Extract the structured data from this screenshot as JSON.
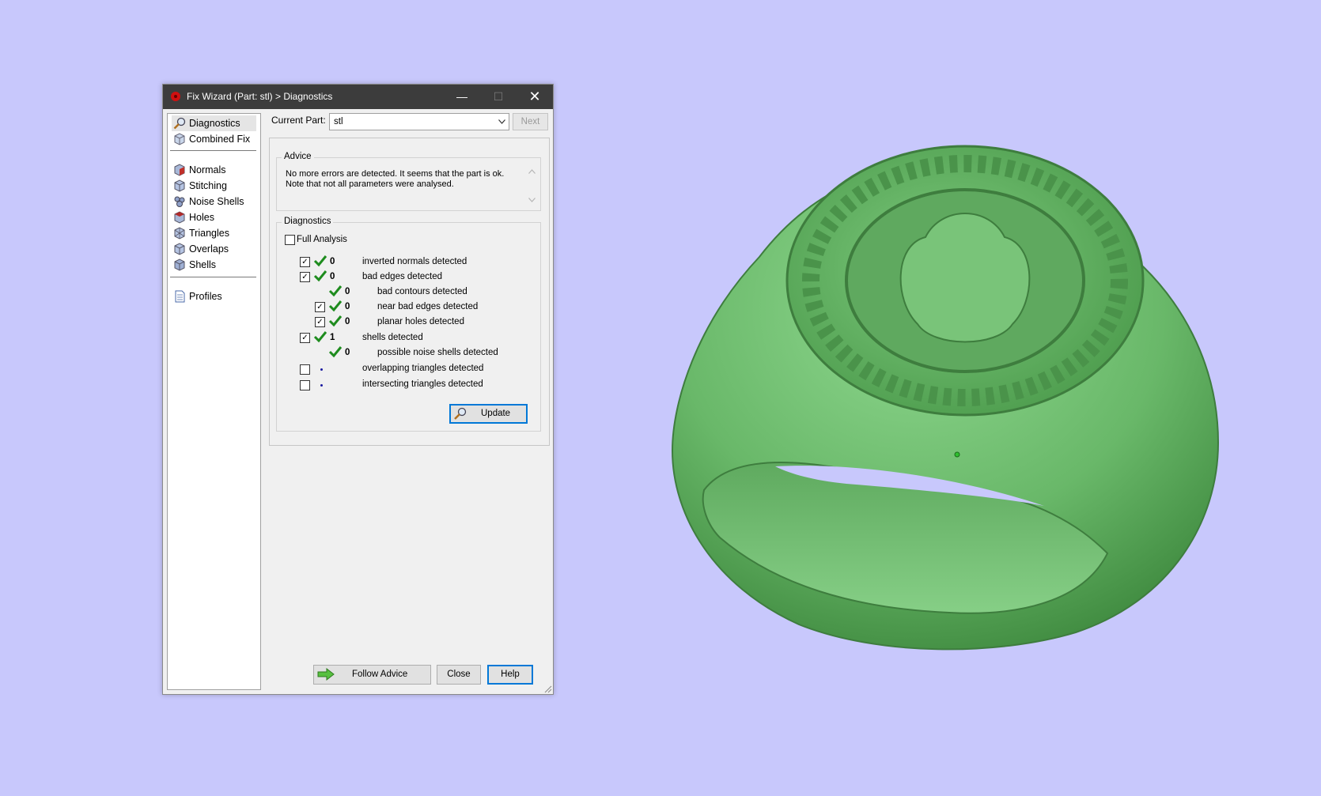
{
  "window": {
    "title": "Fix Wizard (Part: stl) > Diagnostics",
    "minimize": "—",
    "maximize": "☐",
    "close": "✕"
  },
  "nav": {
    "items": [
      {
        "label": "Diagnostics",
        "icon": "magnifier-icon",
        "selected": true
      },
      {
        "label": "Combined Fix",
        "icon": "cube-icon"
      },
      {
        "label": "Normals",
        "icon": "normals-cube-icon"
      },
      {
        "label": "Stitching",
        "icon": "stitching-cube-icon"
      },
      {
        "label": "Noise Shells",
        "icon": "noise-shells-icon"
      },
      {
        "label": "Holes",
        "icon": "holes-cube-icon"
      },
      {
        "label": "Triangles",
        "icon": "triangles-cube-icon"
      },
      {
        "label": "Overlaps",
        "icon": "overlaps-cube-icon"
      },
      {
        "label": "Shells",
        "icon": "shells-cube-icon"
      },
      {
        "label": "Profiles",
        "icon": "document-icon"
      }
    ]
  },
  "current_part": {
    "label": "Current Part:",
    "value": "stl",
    "next_label": "Next"
  },
  "advice": {
    "title": "Advice",
    "line1": "No more errors are detected. It seems that the part is ok.",
    "line2": "Note that not all parameters were analysed."
  },
  "diagnostics": {
    "title": "Diagnostics",
    "full_analysis_label": "Full Analysis",
    "full_analysis_checked": false,
    "rows": [
      {
        "checked": true,
        "status": "check",
        "count": "0",
        "label": "inverted normals detected"
      },
      {
        "checked": true,
        "status": "check",
        "count": "0",
        "label": "bad edges detected"
      },
      {
        "checked": null,
        "status": "check",
        "count": "0",
        "label": "bad contours detected"
      },
      {
        "checked": true,
        "status": "check",
        "count": "0",
        "label": "near bad edges detected"
      },
      {
        "checked": true,
        "status": "check",
        "count": "0",
        "label": "planar holes detected"
      },
      {
        "checked": true,
        "status": "check",
        "count": "1",
        "label": "shells detected"
      },
      {
        "checked": null,
        "status": "check",
        "count": "0",
        "label": "possible noise shells detected"
      },
      {
        "checked": false,
        "status": "dot",
        "count": "",
        "label": "overlapping triangles detected"
      },
      {
        "checked": false,
        "status": "dot",
        "count": "",
        "label": "intersecting triangles detected"
      }
    ],
    "update_label": "Update"
  },
  "footer": {
    "follow_advice_label": "Follow Advice",
    "close_label": "Close",
    "help_label": "Help"
  },
  "colors": {
    "background": "#c8c8fc",
    "model": "#6fbf6f",
    "check": "#1e8c1e",
    "titlebar": "#3c3c3c",
    "accent": "#0078d7"
  }
}
